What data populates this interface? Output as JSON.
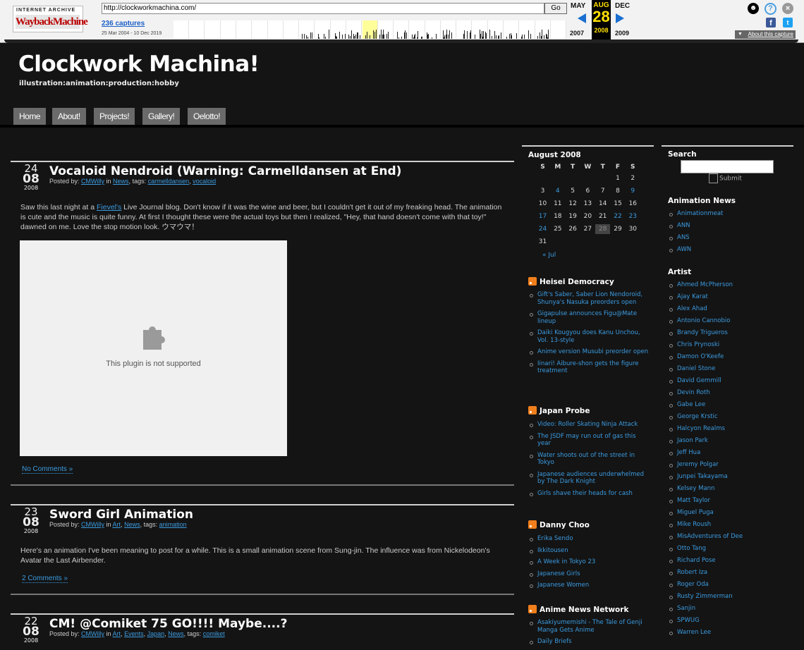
{
  "wayback": {
    "logo_top": "INTERNET ARCHIVE",
    "logo_main": "WaybackMachine",
    "url": "http://clockworkmachina.com/",
    "go": "Go",
    "captures": "236 captures",
    "range": "25 Mar 2004 - 10 Dec 2019",
    "prev_month": "MAY",
    "cur_month": "AUG",
    "next_month": "DEC",
    "cur_day": "28",
    "prev_year": "2007",
    "cur_year": "2008",
    "next_year": "2009",
    "about": "About this capture"
  },
  "site": {
    "title": "Clockwork Machina!",
    "tagline": "illustration:animation:production:hobby",
    "nav": [
      "Home",
      "About!",
      "Projects!",
      "Gallery!",
      "Oelotto!"
    ]
  },
  "posts": [
    {
      "day": "24",
      "month": "08",
      "year": "2008",
      "title": "Vocaloid Nendroid (Warning: Carmelldansen at End)",
      "meta_prefix": "Posted by: ",
      "author": "CMWilly",
      "meta_in": " in ",
      "cats": [
        "News"
      ],
      "meta_tags": ", tags: ",
      "tags": [
        "carmelldansen",
        "vocaloid"
      ],
      "body_pre": "Saw this last night at a ",
      "body_link": "Fievel's",
      "body_post": " Live Journal blog. Don't know if it was the wine and beer, but I couldn't get it out of my freaking head. The animation is cute and the music is quite funny. At first I thought these were the actual toys but then I realized, \"Hey, that hand doesn't come with that toy!\" dawned on me. Love the stop motion look. ウマウマ！",
      "plugin_text": "This plugin is not supported",
      "comments": "No Comments »"
    },
    {
      "day": "23",
      "month": "08",
      "year": "2008",
      "title": "Sword Girl Animation",
      "meta_prefix": "Posted by: ",
      "author": "CMWilly",
      "meta_in": " in ",
      "cats": [
        "Art",
        "News"
      ],
      "meta_tags": ", tags: ",
      "tags": [
        "animation"
      ],
      "body": "Here's an animation I've been meaning to post for a while. This is a small animation scene from Sung-jin. The influence was from Nickelodeon's Avatar the Last Airbender.",
      "comments": "2 Comments »"
    },
    {
      "day": "22",
      "month": "08",
      "year": "2008",
      "title": "CM! @Comiket 75 GO!!!! Maybe....?",
      "meta_prefix": "Posted by: ",
      "author": "CMWilly",
      "meta_in": " in ",
      "cats": [
        "Art",
        "Events",
        "Japan",
        "News"
      ],
      "meta_tags": ", tags: ",
      "tags": [
        "comiket"
      ]
    }
  ],
  "calendar": {
    "title": "August 2008",
    "days": [
      "S",
      "M",
      "T",
      "W",
      "T",
      "F",
      "S"
    ],
    "prev": "« Jul",
    "today": 28,
    "linked": [
      4,
      9,
      17,
      22,
      23,
      24
    ]
  },
  "feeds": [
    {
      "title": "Heisei Democracy",
      "items": [
        "Gift's Saber, Saber Lion Nendoroid, Shunya's Nasuka preorders open",
        "Gigapulse announces Figu@Mate lineup",
        "Daiki Kougyou does Kanu Unchou, Vol. 13-style",
        "Anime version Musubi preorder open",
        "Iinari! Aibure-shon gets the figure treatment"
      ]
    },
    {
      "title": "Japan Probe",
      "items": [
        "Video: Roller Skating Ninja Attack",
        "The JSDF may run out of gas this year",
        "Water shoots out of the street in Tokyo",
        "Japanese audiences underwhelmed by The Dark Knight",
        "Girls shave their heads for cash"
      ]
    },
    {
      "title": "Danny Choo",
      "items": [
        "Erika Sendo",
        "Ikkitousen",
        "A Week in Tokyo 23",
        "Japanese Girls",
        "Japanese Women"
      ]
    },
    {
      "title": "Anime News Network",
      "items": [
        "Asakiyumemishi - The Tale of Genji Manga Gets Anime",
        "Daily Briefs"
      ]
    }
  ],
  "search": {
    "title": "Search",
    "submit": "Submit"
  },
  "animation_news": {
    "title": "Animation News",
    "items": [
      "Animationmeat",
      "ANN",
      "ANS",
      "AWN"
    ]
  },
  "artist": {
    "title": "Artist",
    "items": [
      "Ahmed McPherson",
      "Ajay Karat",
      "Alex Ahad",
      "Antonio Cannobio",
      "Brandy Trigueros",
      "Chris Prynoski",
      "Damon O'Keefe",
      "Daniel Stone",
      "David Gemmill",
      "Devin Roth",
      "Gabe Lee",
      "George Krstic",
      "Halcyon Realms",
      "Jason Park",
      "Jeff Hua",
      "Jeremy Polgar",
      "Junpei Takayama",
      "Kelsey Mann",
      "Matt Taylor",
      "Miguel Puga",
      "Mike Roush",
      "MisAdventures of Dee",
      "Otto Tang",
      "Richard Pose",
      "Robert Iza",
      "Roger Oda",
      "Rusty Zimmerman",
      "Sanjin",
      "SPWUG",
      "Warren Lee"
    ]
  }
}
